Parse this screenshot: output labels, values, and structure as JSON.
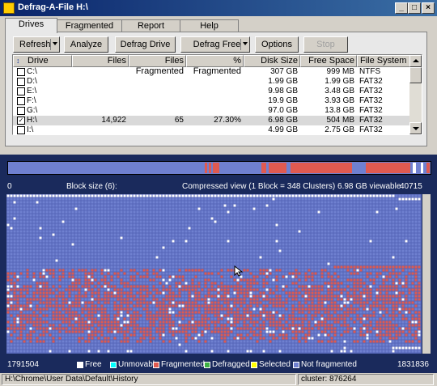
{
  "window": {
    "title": "Defrag-A-File   H:\\",
    "icon": "app-icon",
    "controls": [
      "_",
      "□",
      "×"
    ]
  },
  "tabs": [
    "Drives",
    "Fragmented Files",
    "Report",
    "Help"
  ],
  "active_tab": "Drives",
  "toolbar": {
    "refresh": "Refresh",
    "analyze": "Analyze",
    "defrag_drive": "Defrag Drive",
    "defrag_free_space": "Defrag Free Space",
    "options": "Options",
    "stop": "Stop"
  },
  "drive_list": {
    "columns": [
      "Drive",
      "Files",
      "Files Fragmented",
      "% Fragmented",
      "Disk Size",
      "Free Space",
      "File System"
    ],
    "rows": [
      {
        "checked": false,
        "drive": "C:\\",
        "files": "",
        "files_fragmented": "",
        "pct_fragmented": "",
        "disk_size": "307 GB",
        "free_space": "999 MB",
        "file_system": "NTFS"
      },
      {
        "checked": false,
        "drive": "D:\\",
        "files": "",
        "files_fragmented": "",
        "pct_fragmented": "",
        "disk_size": "1.99 GB",
        "free_space": "1.99 GB",
        "file_system": "FAT32"
      },
      {
        "checked": false,
        "drive": "E:\\",
        "files": "",
        "files_fragmented": "",
        "pct_fragmented": "",
        "disk_size": "9.98 GB",
        "free_space": "3.48 GB",
        "file_system": "FAT32"
      },
      {
        "checked": false,
        "drive": "F:\\",
        "files": "",
        "files_fragmented": "",
        "pct_fragmented": "",
        "disk_size": "19.9 GB",
        "free_space": "3.93 GB",
        "file_system": "FAT32"
      },
      {
        "checked": false,
        "drive": "G:\\",
        "files": "",
        "files_fragmented": "",
        "pct_fragmented": "",
        "disk_size": "97.0 GB",
        "free_space": "13.8 GB",
        "file_system": "FAT32"
      },
      {
        "checked": true,
        "drive": "H:\\",
        "files": "14,922",
        "files_fragmented": "65",
        "pct_fragmented": "27.30%",
        "disk_size": "6.98 GB",
        "free_space": "504 MB",
        "file_system": "FAT32"
      },
      {
        "checked": false,
        "drive": "I:\\",
        "files": "",
        "files_fragmented": "",
        "pct_fragmented": "",
        "disk_size": "4.99 GB",
        "free_space": "2.75 GB",
        "file_system": "FAT32"
      }
    ]
  },
  "cluster_map": {
    "range_start": "0",
    "block_size": "Block size (6):",
    "view_info": "Compressed view (1 Block = 348 Clusters)  6.98 GB viewable",
    "range_end": "40715",
    "footer_start": "1791504",
    "footer_end": "1831836"
  },
  "legend": [
    {
      "label": "Free",
      "color": "#ffffff"
    },
    {
      "label": "Unmovable",
      "color": "#00ffff"
    },
    {
      "label": "Fragmented",
      "color": "#e05a50"
    },
    {
      "label": "Defragged",
      "color": "#3cb043"
    },
    {
      "label": "Selected",
      "color": "#ffff00"
    },
    {
      "label": "Not fragmented",
      "color": "#6f80d0"
    }
  ],
  "status": {
    "path": "H:\\Chrome\\User Data\\Default\\History",
    "cluster": "cluster: 876264"
  },
  "colors": {
    "fragmented": "#e05a50",
    "not_fragmented": "#6f80d0",
    "free": "#ffffff",
    "background": "#1a2a5c"
  }
}
